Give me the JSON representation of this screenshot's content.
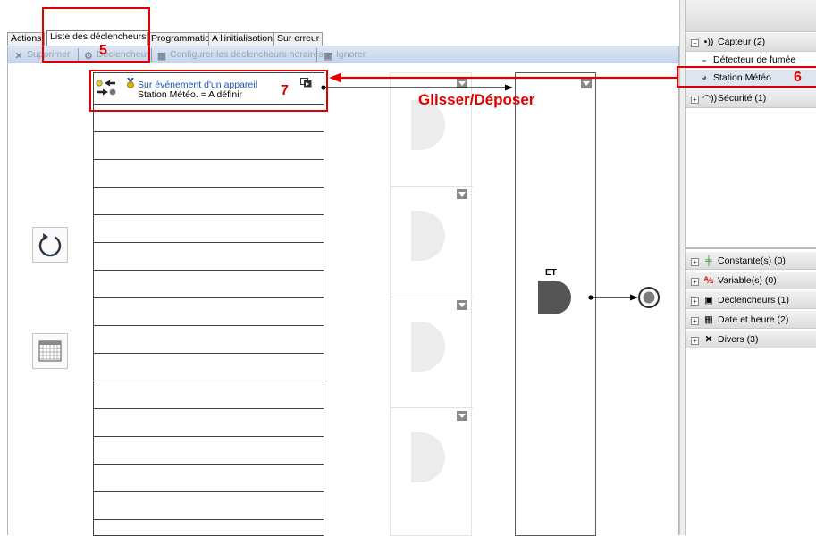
{
  "tabs": [
    {
      "label": "Actions"
    },
    {
      "label": "Liste des déclencheurs"
    },
    {
      "label": "Programmation"
    },
    {
      "label": "A l'initialisation"
    },
    {
      "label": "Sur erreur"
    }
  ],
  "active_tab": 1,
  "toolbar": {
    "delete_label": "Supprimer",
    "trigger_label": "Déclencheur",
    "configure_label": "Configurer les déclencheurs horaires",
    "ignore_label": "Ignorer"
  },
  "trigger": {
    "title": "Sur événement d'un appareil",
    "detail": "Station Météo. = A définir"
  },
  "gate": {
    "label": "ET"
  },
  "device_tree": {
    "capteur": "Capteur (2)",
    "detecteur": "Détecteur de fumée",
    "station": "Station Météo",
    "securite": "Sécurité (1)"
  },
  "palette": {
    "constantes": "Constante(s) (0)",
    "variables": "Variable(s) (0)",
    "declencheurs": "Déclencheurs (1)",
    "date_heure": "Date et heure (2)",
    "divers": "Divers (3)"
  },
  "annotations": {
    "n5": "5",
    "n6": "6",
    "n7": "7",
    "drag_label": "Glisser/Déposer",
    "accent_color": "#e00000"
  }
}
